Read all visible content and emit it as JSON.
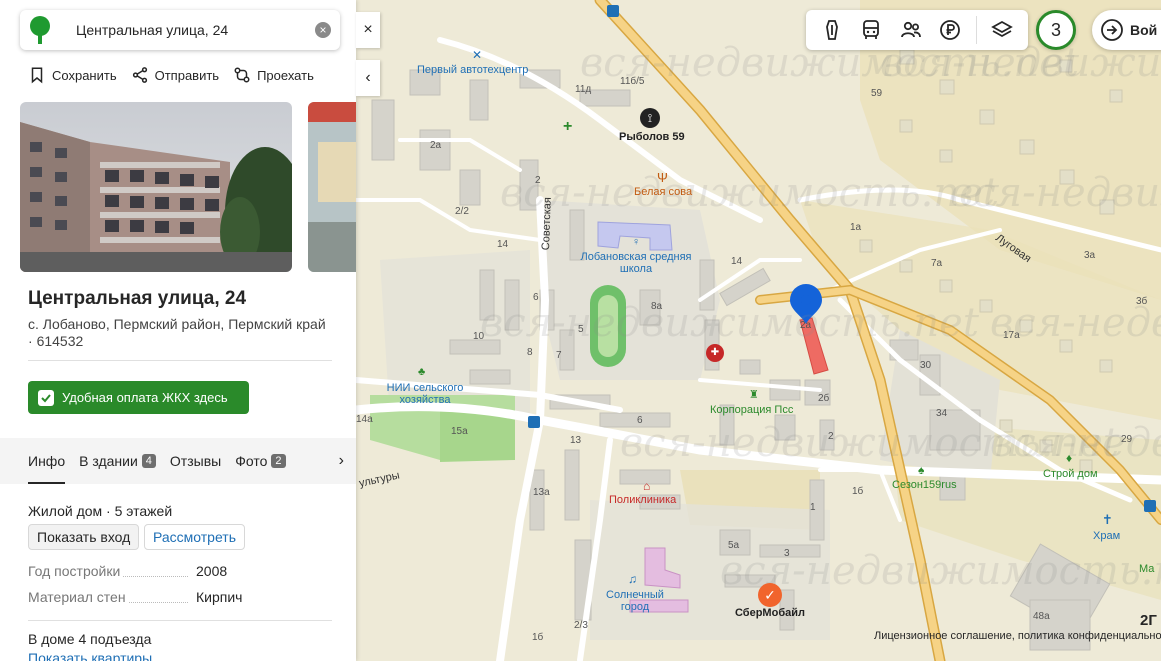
{
  "search": {
    "query": "Центральная улица, 24",
    "clear_icon": "clear-icon",
    "logo_icon": "tree-logo-icon"
  },
  "actions": {
    "save": "Сохранить",
    "share": "Отправить",
    "route": "Проехать"
  },
  "place": {
    "title": "Центральная улица, 24",
    "address": "с. Лобаново, Пермский район, Пермский край",
    "postcode": "614532",
    "promo": "Удобная оплата ЖКХ здесь"
  },
  "tabs": [
    {
      "label": "Инфо",
      "count": ""
    },
    {
      "label": "В здании",
      "count": "4"
    },
    {
      "label": "Отзывы",
      "count": ""
    },
    {
      "label": "Фото",
      "count": "2"
    }
  ],
  "building": {
    "type": "Жилой дом",
    "floors": "5 этажей",
    "show_entrance": "Показать вход",
    "view": "Рассмотреть",
    "year_label": "Год постройки",
    "year_value": "2008",
    "material_label": "Материал стен",
    "material_value": "Кирпич",
    "entrances": "В доме 4 подъезда",
    "show_flats": "Показать квартиры"
  },
  "controls": {
    "close": "×",
    "collapse": "‹",
    "notifications": "3",
    "login": "Вой"
  },
  "map": {
    "license": "Лицензионное соглашение, политика конфиденциальности",
    "brand": "2Г",
    "watermark": "вся-недвижимость.net",
    "pois": {
      "autocenter": "Первый автотехцентр",
      "fisher": "Рыболов 59",
      "owl": "Белая сова",
      "school": "Лобановская средняя школа",
      "nii": "НИИ сельского хозяйства",
      "corp": "Корпорация Псс",
      "clinic": "Поликлиника",
      "sunny": "Солнечный город",
      "sber": "СберМобайл",
      "season": "Сезон159rus",
      "build": "Строй дом",
      "church": "Храм",
      "mag": "Ма"
    },
    "streets": {
      "sovetskaya": "Советская",
      "lugovaya": "Луговая",
      "kultury": "ультуры"
    },
    "houses": [
      "11б/5",
      "11д",
      "59",
      "2а",
      "2",
      "2/2",
      "14",
      "6",
      "10",
      "8",
      "7",
      "5",
      "6",
      "8а",
      "14",
      "2б",
      "2",
      "1б",
      "1",
      "5а",
      "3",
      "13",
      "13а",
      "15а",
      "2/3",
      "1б",
      "14а",
      "1а",
      "7а",
      "3а",
      "3б",
      "17а",
      "30",
      "34",
      "29",
      "2а",
      "48а"
    ]
  }
}
